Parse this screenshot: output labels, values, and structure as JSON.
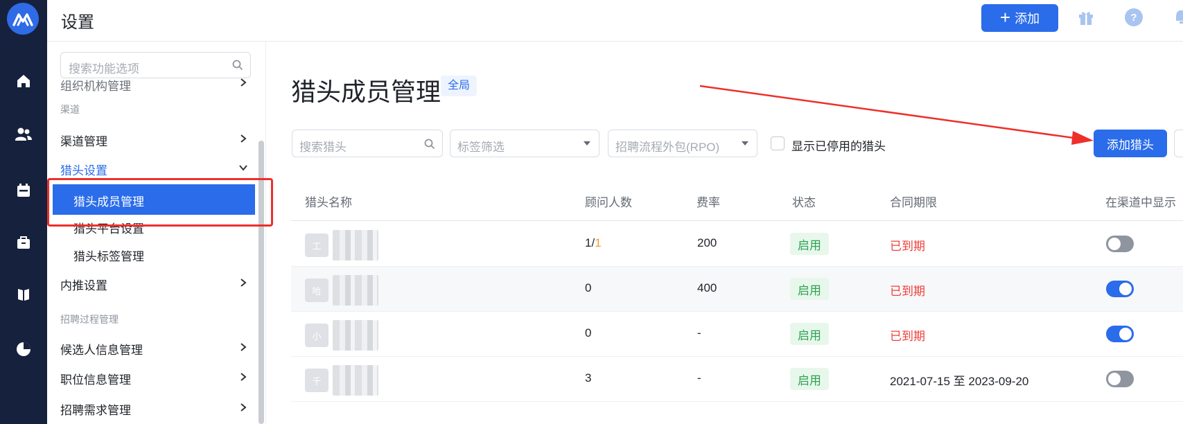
{
  "colors": {
    "rail": "#16213d",
    "primary": "#2a6cea",
    "annotation": "#ee2f2a",
    "enabled": "#2ea352",
    "expired": "#ee3f3a"
  },
  "header": {
    "title": "设置",
    "add_label": "添加"
  },
  "rail": {
    "icons": [
      "home-icon",
      "people-icon",
      "calendar-icon",
      "briefcase-icon",
      "book-icon",
      "pie-chart-icon"
    ]
  },
  "sidebar": {
    "search_placeholder": "搜索功能选项",
    "partial_item": "组织机构管理",
    "section_channel": "渠道",
    "channel_mgmt": "渠道管理",
    "headhunter_settings": "猎头设置",
    "sub_member": "猎头成员管理",
    "sub_platform": "猎头平台设置",
    "sub_tags": "猎头标签管理",
    "referral": "内推设置",
    "section_process": "招聘过程管理",
    "candidate_info": "候选人信息管理",
    "position_info": "职位信息管理",
    "demand_mgmt": "招聘需求管理"
  },
  "main": {
    "title": "猎头成员管理",
    "scope": "全局",
    "search_placeholder": "搜索猎头",
    "tag_filter": "标签筛选",
    "rpo_filter": "招聘流程外包(RPO)",
    "show_disabled": "显示已停用的猎头",
    "add_headhunter": "添加猎头"
  },
  "table": {
    "headers": [
      "猎头名称",
      "顾问人数",
      "费率",
      "状态",
      "合同期限",
      "在渠道中显示"
    ],
    "rows": [
      {
        "avatar": "工",
        "consultants": "1",
        "consultants_sep": "/",
        "consultants_extra": "1",
        "rate": "200",
        "status": "启用",
        "contract": "已到期",
        "contract_expired": true,
        "shown": false
      },
      {
        "avatar": "哈",
        "consultants": "0",
        "consultants_sep": "",
        "consultants_extra": "",
        "rate": "400",
        "status": "启用",
        "contract": "已到期",
        "contract_expired": true,
        "shown": true
      },
      {
        "avatar": "小",
        "consultants": "0",
        "consultants_sep": "",
        "consultants_extra": "",
        "rate": "-",
        "status": "启用",
        "contract": "已到期",
        "contract_expired": true,
        "shown": true
      },
      {
        "avatar": "千",
        "consultants": "3",
        "consultants_sep": "",
        "consultants_extra": "",
        "rate": "-",
        "status": "启用",
        "contract": "2021-07-15 至 2023-09-20",
        "contract_expired": false,
        "shown": false
      }
    ]
  }
}
